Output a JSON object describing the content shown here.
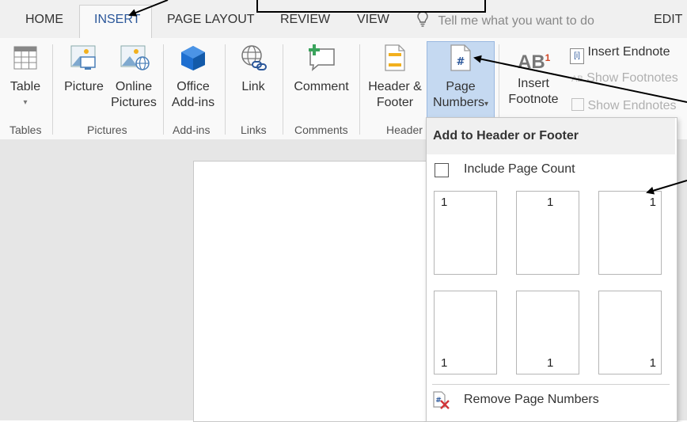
{
  "tabs": [
    {
      "label": "HOME"
    },
    {
      "label": "INSERT"
    },
    {
      "label": "PAGE LAYOUT"
    },
    {
      "label": "REVIEW"
    },
    {
      "label": "VIEW"
    },
    {
      "label": "EDIT"
    }
  ],
  "tell_me": "Tell me what you want to do",
  "ribbon": {
    "table": {
      "line1": "Table",
      "caret": "▾"
    },
    "picture": {
      "line1": "Picture"
    },
    "online_pictures": {
      "line1": "Online",
      "line2": "Pictures"
    },
    "office_addins": {
      "line1": "Office",
      "line2": "Add-ins"
    },
    "link": {
      "line1": "Link"
    },
    "comment": {
      "line1": "Comment"
    },
    "header_footer": {
      "line1": "Header &",
      "line2": "Footer"
    },
    "page_numbers": {
      "line1": "Page",
      "line2": "Numbers",
      "caret": "▾"
    },
    "insert_footnote": {
      "line1": "Insert",
      "line2": "Footnote"
    },
    "insert_endnote": "Insert Endnote",
    "show_footnotes": "Show Footnotes",
    "show_endnotes": "Show Endnotes",
    "groups": {
      "tables": "Tables",
      "pictures": "Pictures",
      "addins": "Add-ins",
      "links": "Links",
      "comments": "Comments",
      "header": "Header"
    }
  },
  "dropdown": {
    "header": "Add to Header or Footer",
    "include_page_count": "Include Page Count",
    "thumbnails": [
      "1",
      "1",
      "1",
      "1",
      "1",
      "1"
    ],
    "remove": "Remove Page Numbers"
  },
  "colors": {
    "accent": "#2b579a",
    "selected_button": "#c5d9f1"
  }
}
